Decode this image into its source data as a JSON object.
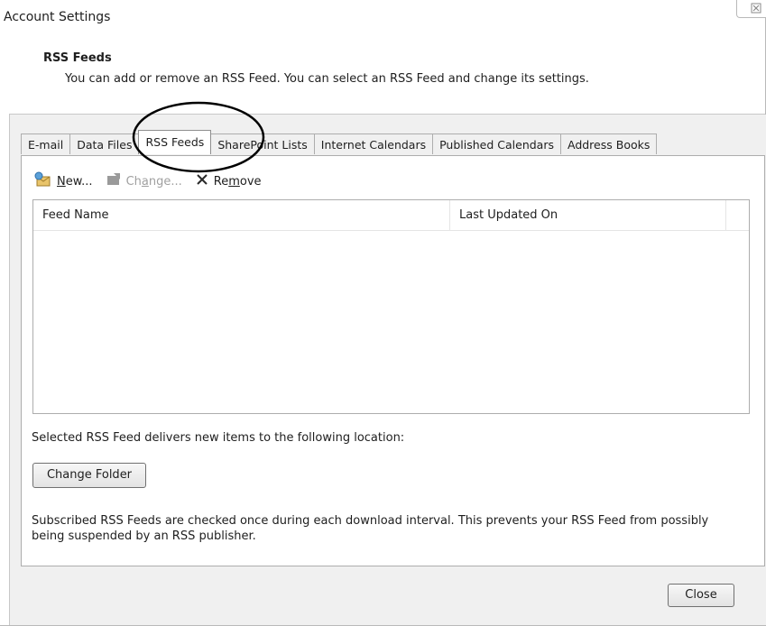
{
  "window": {
    "title": "Account Settings",
    "close_glyph": "⌧"
  },
  "header": {
    "title": "RSS Feeds",
    "description": "You can add or remove an RSS Feed. You can select an RSS Feed and change its settings."
  },
  "tabs": [
    {
      "label": "E-mail",
      "active": false
    },
    {
      "label": "Data Files",
      "active": false
    },
    {
      "label": "RSS Feeds",
      "active": true
    },
    {
      "label": "SharePoint Lists",
      "active": false
    },
    {
      "label": "Internet Calendars",
      "active": false
    },
    {
      "label": "Published Calendars",
      "active": false
    },
    {
      "label": "Address Books",
      "active": false
    }
  ],
  "toolbar": {
    "new_label_u": "N",
    "new_label_rest": "ew...",
    "change_label_a": "Ch",
    "change_label_u": "a",
    "change_label_rest": "nge...",
    "remove_label_a": "Re",
    "remove_label_u": "m",
    "remove_label_rest": "ove",
    "new_icon": "new-feed-icon",
    "change_icon": "change-icon",
    "remove_icon": "remove-x-icon"
  },
  "feeds_table": {
    "columns": [
      "Feed Name",
      "Last Updated On"
    ],
    "rows": []
  },
  "location_text": "Selected RSS Feed delivers new items to the following location:",
  "change_folder_label": "Change Folder",
  "note": "Subscribed RSS Feeds are checked once during each download interval. This prevents your RSS Feed from possibly being suspended by an RSS publisher.",
  "close_label": "Close"
}
